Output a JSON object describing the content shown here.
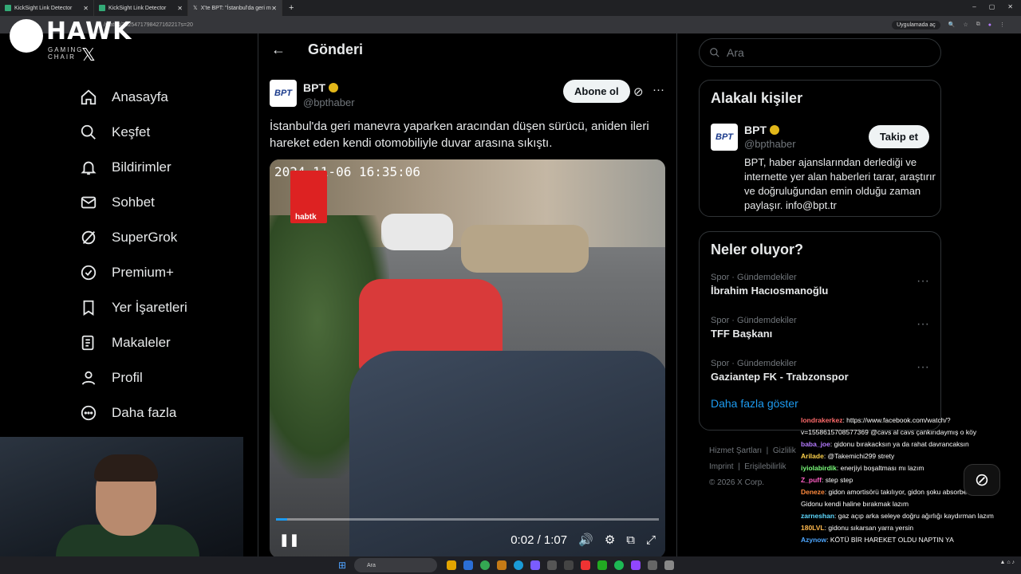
{
  "browser": {
    "tabs": [
      {
        "label": "KickSight Link Detector"
      },
      {
        "label": "KickSight Link Detector"
      },
      {
        "label": "X'te BPT: \"İstanbul'da geri m"
      }
    ],
    "url": "/status/2025471798427162217s=20",
    "translate_pill": "Uygulamada aç"
  },
  "overlay": {
    "logo": "HAWK",
    "logo_sub": "GAMING CHAIR"
  },
  "nav": {
    "items": [
      {
        "label": "Anasayfa",
        "icon": "home-icon"
      },
      {
        "label": "Keşfet",
        "icon": "search-icon"
      },
      {
        "label": "Bildirimler",
        "icon": "bell-icon"
      },
      {
        "label": "Sohbet",
        "icon": "mail-icon"
      },
      {
        "label": "SuperGrok",
        "icon": "grok-icon"
      },
      {
        "label": "Premium+",
        "icon": "verified-icon"
      },
      {
        "label": "Yer İşaretleri",
        "icon": "bookmark-icon"
      },
      {
        "label": "Makaleler",
        "icon": "article-icon"
      },
      {
        "label": "Profil",
        "icon": "profile-icon"
      },
      {
        "label": "Daha fazla",
        "icon": "more-circle-icon"
      }
    ]
  },
  "header": {
    "title": "Gönderi"
  },
  "post": {
    "author_name": "BPT",
    "author_handle": "@bpthaber",
    "avatar_text": "BPT",
    "subscribe": "Abone ol",
    "text": "İstanbul'da geri manevra yaparken aracından düşen sürücü, aniden ileri hareket eden kendi otomobiliyle duvar arasına sıkıştı.",
    "video": {
      "timestamp": "2024-11-06 16:35:06",
      "channel_logo": "h",
      "channel_sub": "habtk",
      "time": "0:02 / 1:07",
      "progress": 0.03
    }
  },
  "sidebar": {
    "search_placeholder": "Ara",
    "related_title": "Alakalı kişiler",
    "related": {
      "name": "BPT",
      "handle": "@bpthaber",
      "follow": "Takip et",
      "bio": "BPT, haber ajanslarından derlediği ve internette yer alan haberleri tarar, araştırır ve doğruluğundan emin olduğu zaman paylaşır. info@bpt.tr"
    },
    "trends_title": "Neler oluyor?",
    "trends": [
      {
        "category": "Spor · Gündemdekiler",
        "title": "İbrahim Hacıosmanoğlu"
      },
      {
        "category": "Spor · Gündemdekiler",
        "title": "TFF Başkanı"
      },
      {
        "category": "Spor · Gündemdekiler",
        "title": "Gaziantep FK - Trabzonspor"
      }
    ],
    "show_more": "Daha fazla göster",
    "footer": [
      "Hizmet Şartları",
      "Gizlilik",
      "Imprint",
      "Erişilebilirlik",
      "© 2026 X Corp."
    ]
  },
  "chat": [
    {
      "user": "londrakerkez",
      "color": "#ff6b6b",
      "text": ": https://www.facebook.com/watch/?v=1558615708577369 @cavs al cavs çankırıdaymış o köy"
    },
    {
      "user": "baba_joe",
      "color": "#b57bff",
      "text": ": gidonu bırakacksın ya da rahat davrancaksın"
    },
    {
      "user": "Arilade",
      "color": "#ffd34d",
      "text": ": @Takemichi299 strety"
    },
    {
      "user": "iyiolabirdik",
      "color": "#7cff7c",
      "text": ": enerjiyi boşaltması mı lazım"
    },
    {
      "user": "Z_puff",
      "color": "#ff5ec4",
      "text": ": step step"
    },
    {
      "user": "Deneze",
      "color": "#ff8a3d",
      "text": ": gidon amortisörü takılıyor, gidon şoku absorbe ediyor. Gidonu kendi haline bırakmak lazım"
    },
    {
      "user": "zarneshan",
      "color": "#5ed9ff",
      "text": ": gaz açıp arka seleye doğru ağırlığı kaydırman lazım"
    },
    {
      "user": "180LVL",
      "color": "#ffb84d",
      "text": ": gidonu sıkarsan yarra yersin"
    },
    {
      "user": "Azynow",
      "color": "#4da6ff",
      "text": ": KÖTÜ BİR HAREKET OLDU NAPTIN YA"
    }
  ],
  "taskbar": {
    "search": "Ara"
  }
}
